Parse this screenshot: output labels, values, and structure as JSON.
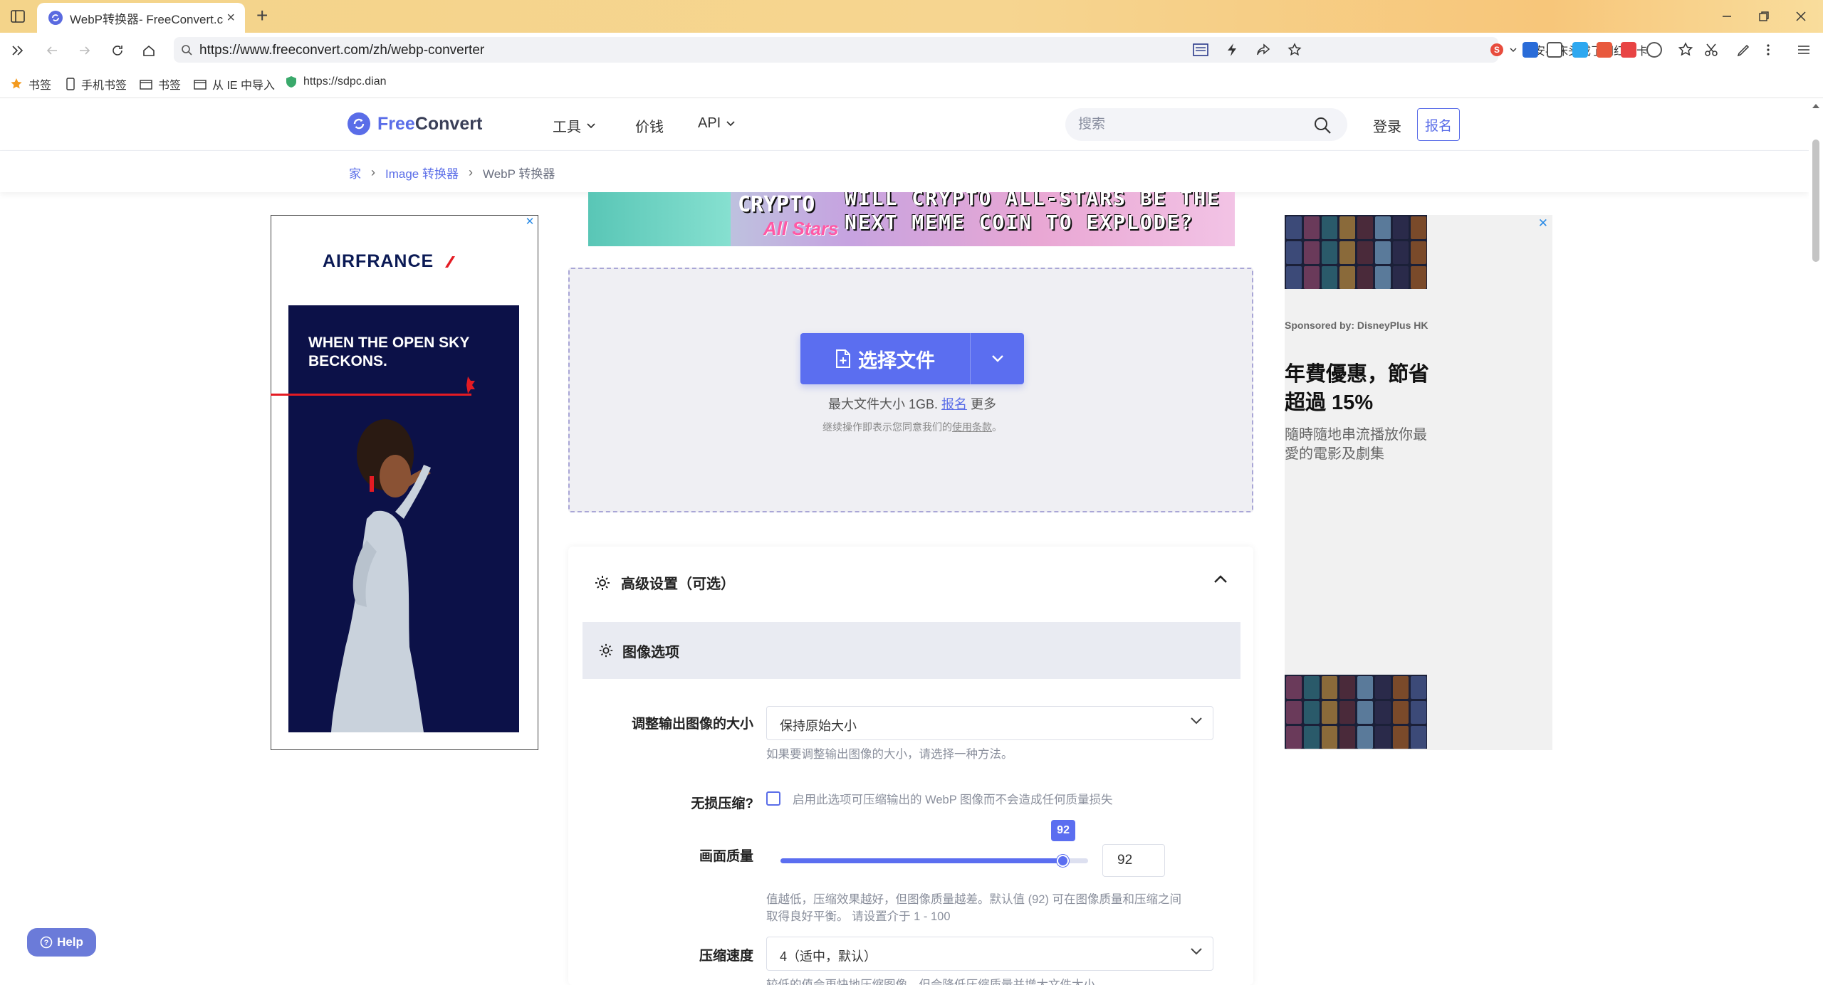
{
  "browser": {
    "tab_title": "WebP转换器- FreeConvert.com",
    "url": "https://www.freeconvert.com/zh/webp-converter",
    "news_ticker": "韩安冉床头成了网红打卡点"
  },
  "bookmarks": [
    {
      "label": "书签",
      "icon": "star-icon"
    },
    {
      "label": "手机书签",
      "icon": "phone-icon"
    },
    {
      "label": "书签",
      "icon": "folder-icon"
    },
    {
      "label": "从 IE 中导入",
      "icon": "folder-icon"
    },
    {
      "label": "https://sdpc.dian",
      "icon": "shield-icon"
    }
  ],
  "site": {
    "logo_free": "Free",
    "logo_convert": "Convert",
    "nav": [
      "工具",
      "价钱",
      "API"
    ],
    "search_placeholder": "搜索",
    "login": "登录",
    "signup": "报名"
  },
  "breadcrumb": [
    "家",
    "Image 转换器",
    "WebP 转换器"
  ],
  "ads": {
    "left_brand": "AIRFRANCE",
    "left_slogan": "WHEN THE OPEN SKY BECKONS.",
    "top_banner_line1": "WILL CRYPTO ALL-STARS BE THE",
    "top_banner_line2": "NEXT MEME COIN TO EXPLODE?",
    "top_banner_crypto": "CRYPTO",
    "top_banner_allstars": "All Stars",
    "right_sponsor": "Sponsored by: DisneyPlus HK",
    "right_headline": "年費優惠，節省超過 15%",
    "right_subline": "隨時隨地串流播放你最愛的電影及劇集"
  },
  "upload": {
    "choose_button": "选择文件",
    "max_size_prefix": "最大文件大小 1GB.",
    "max_size_link": "报名",
    "max_size_suffix": "更多",
    "terms_prefix": "继续操作即表示您同意我们的",
    "terms_link": "使用条款",
    "terms_suffix": "。"
  },
  "settings": {
    "title": "高级设置（可选）",
    "section": "图像选项",
    "resize_label": "调整输出图像的大小",
    "resize_value": "保持原始大小",
    "resize_hint": "如果要调整输出图像的大小，请选择一种方法。",
    "lossless_label": "无损压缩?",
    "lossless_hint": "启用此选项可压缩输出的 WebP 图像而不会造成任何质量损失",
    "lossless_checked": false,
    "quality_label": "画面质量",
    "quality_value": "92",
    "quality_min": 1,
    "quality_max": 100,
    "quality_hint_line1": "值越低，压缩效果越好，但图像质量越差。默认值 (92) 可在图像质量和压缩之间",
    "quality_hint_line2": "取得良好平衡。 请设置介于 1 - 100",
    "speed_label": "压缩速度",
    "speed_value": "4（适中，默认）",
    "speed_hint": "较低的值会更快地压缩图像，但会降低压缩质量并增大文件大小"
  },
  "help": "Help",
  "colors": {
    "brand": "#5a6de8",
    "button": "#5b6ef0",
    "tabbar": "#f4d48a"
  }
}
